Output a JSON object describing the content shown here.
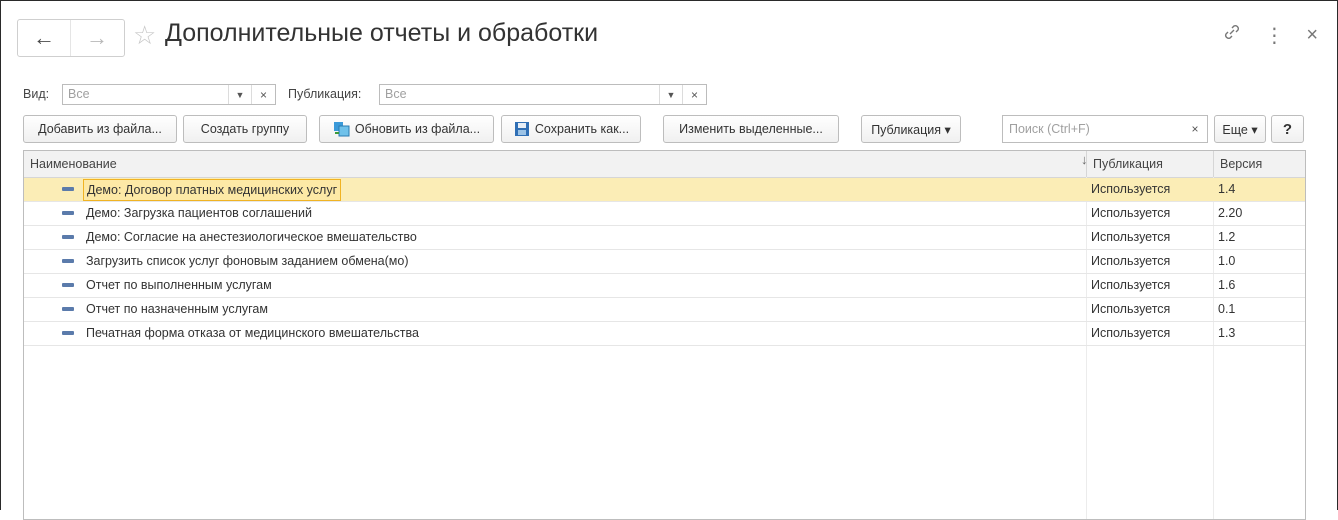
{
  "window": {
    "title": "Дополнительные отчеты и обработки",
    "back_icon": "←",
    "forward_icon": "→",
    "star_icon": "☆",
    "link_icon": "🔗",
    "more_icon": "⋮",
    "close_icon": "×"
  },
  "filters": {
    "type_label": "Вид:",
    "type_value": "Все",
    "publication_label": "Публикация:",
    "publication_value": "Все",
    "dropdown_glyph": "▼",
    "clear_glyph": "×"
  },
  "toolbar": {
    "add_from_file": "Добавить из файла...",
    "create_group": "Создать группу",
    "update_from_file": "Обновить из файла...",
    "save_as": "Сохранить как...",
    "change_selected": "Изменить выделенные...",
    "publication": "Публикация ▾",
    "search_placeholder": "Поиск (Ctrl+F)",
    "search_clear": "×",
    "more": "Еще ▾",
    "help": "?"
  },
  "table": {
    "columns": {
      "name": "Наименование",
      "publication": "Публикация",
      "version": "Версия",
      "sort_indicator": "↓"
    },
    "rows": [
      {
        "name": "Демо: Договор платных медицинских услуг",
        "publication": "Используется",
        "version": "1.4"
      },
      {
        "name": "Демо: Загрузка пациентов соглашений",
        "publication": "Используется",
        "version": "2.20"
      },
      {
        "name": "Демо: Согласие на анестезиологическое вмешательство",
        "publication": "Используется",
        "version": "1.2"
      },
      {
        "name": "Загрузить список услуг фоновым заданием обмена(мо)",
        "publication": "Используется",
        "version": "1.0"
      },
      {
        "name": "Отчет по выполненным услугам",
        "publication": "Используется",
        "version": "1.6"
      },
      {
        "name": "Отчет по назначенным услугам",
        "publication": "Используется",
        "version": "0.1"
      },
      {
        "name": "Печатная форма отказа от медицинского вмешательства",
        "publication": "Используется",
        "version": "1.3"
      }
    ]
  },
  "colors": {
    "selected_row": "#fbedb6",
    "focus_border": "#f0b323",
    "row_icon": "#5b7bab"
  }
}
